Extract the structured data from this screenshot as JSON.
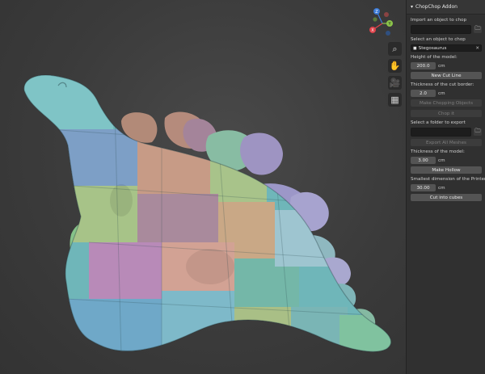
{
  "viewport": {
    "gizmo": {
      "z": "Z",
      "y": "Y",
      "x": "X"
    },
    "tools": [
      {
        "name": "zoom-icon",
        "glyph": "⌕"
      },
      {
        "name": "pan-hand-icon",
        "glyph": "✋"
      },
      {
        "name": "camera-icon",
        "glyph": "🎥"
      },
      {
        "name": "grid-icon",
        "glyph": "▦"
      }
    ]
  },
  "panel": {
    "title": "ChopChop Addon",
    "import_label": "Import an object to chop",
    "import_value": "",
    "select_label": "Select an object to chop",
    "selected_object": "Stegosaurus",
    "height_label": "Height of the model:",
    "height_value": "200.0",
    "height_unit": "cm",
    "new_cut_line": "New Cut Line",
    "thickness_border_label": "Thickness of the cut border:",
    "thickness_border_value": "2.0",
    "thickness_border_unit": "cm",
    "make_chopping_objects": "Make Chopping Objects",
    "chop_it": "Chop it",
    "export_folder_label": "Select a folder to export",
    "export_folder_value": "",
    "export_all_meshes": "Export All Meshes",
    "thickness_model_label": "Thickness of the model:",
    "thickness_model_value": "3.00",
    "thickness_model_unit": "cm",
    "make_hollow": "Make Hollow",
    "smallest_dim_label": "Smallest dimension of the Printer:",
    "smallest_dim_value": "30.00",
    "smallest_dim_unit": "cm",
    "cut_into_cubes": "Cut into cubes"
  },
  "colors": {
    "accent_z": "#3d7bd6",
    "accent_y": "#8bc34a",
    "accent_x": "#e0434b"
  }
}
